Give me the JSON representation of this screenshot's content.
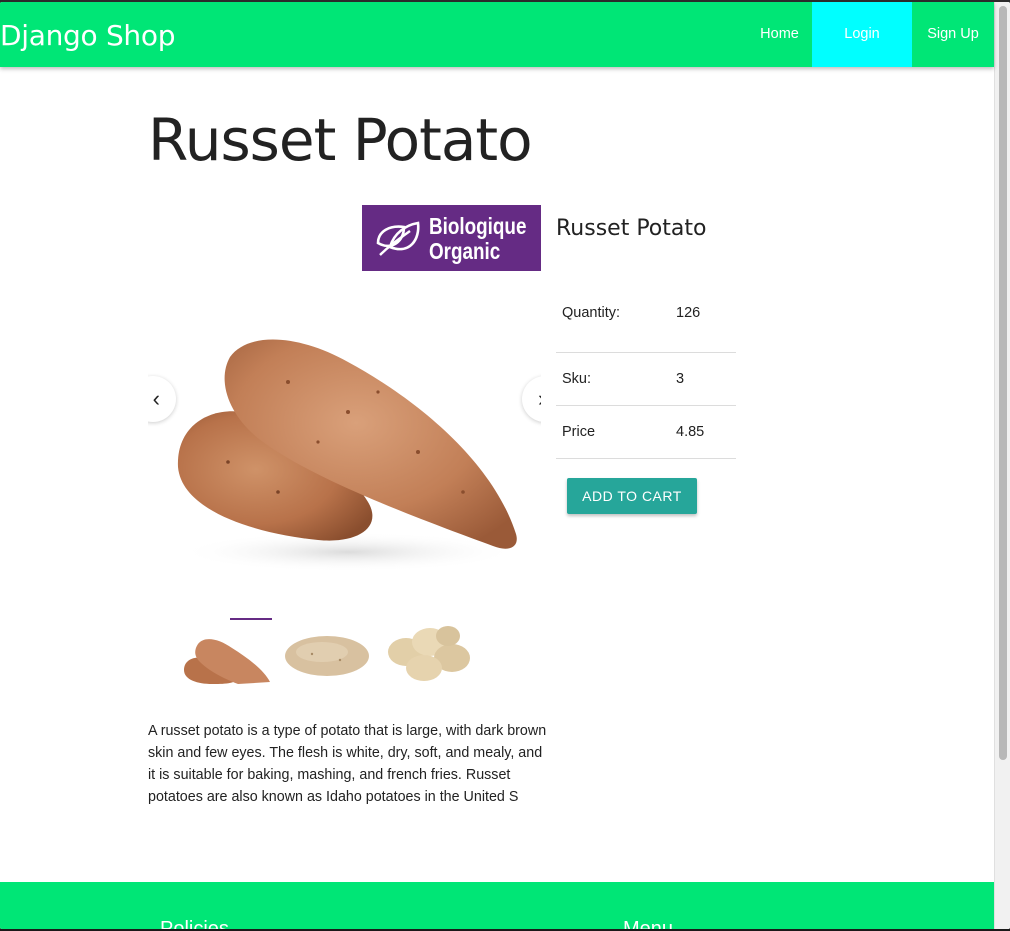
{
  "navbar": {
    "brand": "Django Shop",
    "links": {
      "home": "Home",
      "login": "Login",
      "signup": "Sign Up"
    },
    "colors": {
      "bar": "#00e676",
      "active_link": "#00ffff"
    }
  },
  "product": {
    "title": "Russet Potato",
    "name": "Russet Potato",
    "badge": {
      "line1": "Biologique",
      "line2": "Organic",
      "color": "#652b84"
    },
    "carousel": {
      "prev_icon": "chevron-left-icon",
      "next_icon": "chevron-right-icon",
      "thumbnail_count": 3,
      "active_thumbnail": 1
    },
    "details": [
      {
        "label": "Quantity:",
        "value": "126"
      },
      {
        "label": "Sku:",
        "value": "3"
      },
      {
        "label": "Price",
        "value": "4.85"
      }
    ],
    "add_to_cart": "ADD TO CART",
    "description": "A russet potato is a type of potato that is large, with dark brown skin and few eyes. The flesh is white, dry, soft, and mealy, and it is suitable for baking, mashing, and french fries. Russet potatoes are also known as Idaho potatoes in the United S"
  },
  "footer": {
    "headings": [
      "Policies",
      "Menu"
    ]
  }
}
